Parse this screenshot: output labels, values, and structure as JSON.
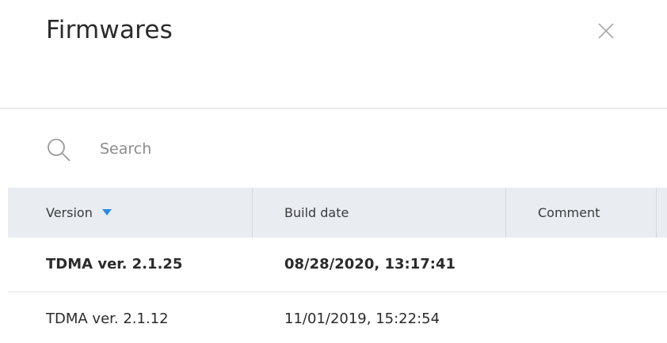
{
  "dialog": {
    "title": "Firmwares",
    "close_icon": "close-icon"
  },
  "search": {
    "icon": "search-icon",
    "placeholder": "Search",
    "value": ""
  },
  "table": {
    "columns": [
      {
        "label": "Version",
        "sorted": "desc"
      },
      {
        "label": "Build date"
      },
      {
        "label": "Comment"
      }
    ],
    "rows": [
      {
        "version": "TDMA ver. 2.1.25",
        "build_date": "08/28/2020, 13:17:41",
        "comment": "",
        "emphasis": "bold"
      },
      {
        "version": "TDMA ver. 2.1.12",
        "build_date": "11/01/2019, 15:22:54",
        "comment": "",
        "emphasis": "normal"
      }
    ]
  },
  "colors": {
    "header_bg": "#e9edf2",
    "sort_arrow": "#2a8ce6"
  }
}
